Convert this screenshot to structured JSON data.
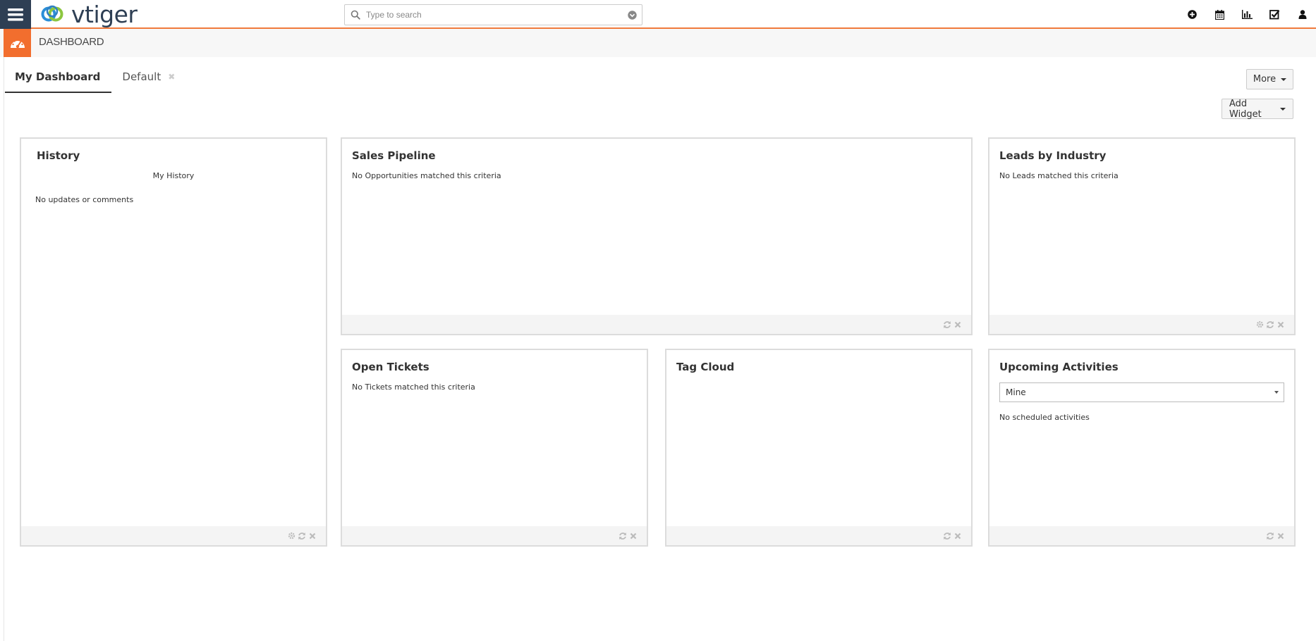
{
  "brand": {
    "logo_text": "vtiger",
    "accent": "#f07a3b",
    "dark": "#2e3f54"
  },
  "search": {
    "placeholder": "Type to search"
  },
  "module": {
    "title": "DASHBOARD"
  },
  "tabs": [
    {
      "label": "My Dashboard",
      "active": true
    },
    {
      "label": "Default",
      "active": false,
      "closable": true
    }
  ],
  "actions": {
    "more_label": "More",
    "add_widget_label": "Add Widget"
  },
  "widgets": {
    "history": {
      "title": "History",
      "subtitle": "My History",
      "message": "No updates or comments"
    },
    "sales_pipeline": {
      "title": "Sales Pipeline",
      "message": "No Opportunities matched this criteria"
    },
    "leads_by_industry": {
      "title": "Leads by Industry",
      "message": "No Leads matched this criteria"
    },
    "open_tickets": {
      "title": "Open Tickets",
      "message": "No Tickets matched this criteria"
    },
    "tag_cloud": {
      "title": "Tag Cloud"
    },
    "upcoming_activities": {
      "title": "Upcoming Activities",
      "filter_value": "Mine",
      "message": "No scheduled activities"
    }
  },
  "icons": {
    "top": [
      "plus-circle-icon",
      "calendar-icon",
      "bar-chart-icon",
      "check-square-icon",
      "user-icon"
    ],
    "footer": [
      "gear-icon",
      "refresh-icon",
      "close-icon"
    ]
  }
}
